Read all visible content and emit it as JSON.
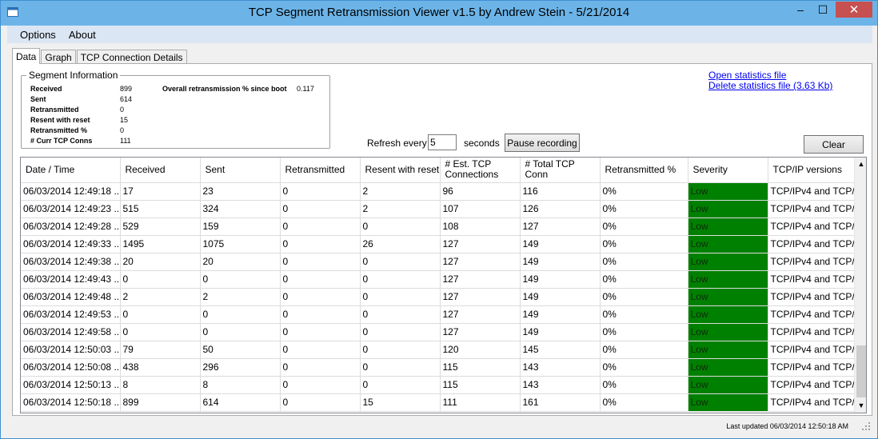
{
  "window": {
    "title": "TCP Segment Retransmission Viewer v1.5 by Andrew Stein - 5/21/2014",
    "minimize_glyph": "–",
    "maximize_glyph": "☐",
    "close_glyph": "✕"
  },
  "menu": [
    {
      "label": "Options"
    },
    {
      "label": "About"
    }
  ],
  "tabs": [
    {
      "label": "Data",
      "active": true
    },
    {
      "label": "Graph",
      "active": false
    },
    {
      "label": "TCP Connection Details",
      "active": false
    }
  ],
  "segment_info": {
    "title": "Segment Information",
    "stats": [
      {
        "label": "Received",
        "value": "899"
      },
      {
        "label": "Sent",
        "value": "614"
      },
      {
        "label": "Retransmitted",
        "value": "0"
      },
      {
        "label": "Resent with reset",
        "value": "15"
      },
      {
        "label": "Retransmitted %",
        "value": "0"
      },
      {
        "label": "# Curr TCP Conns",
        "value": "111"
      }
    ],
    "overall_label": "Overall retransmission % since boot",
    "overall_value": "0.117"
  },
  "links": {
    "open_stats": "Open statistics file",
    "delete_stats": "Delete statistics file (3.63 Kb)"
  },
  "refresh": {
    "label": "Refresh every",
    "value": "5",
    "unit": "seconds",
    "pause_button": "Pause recording"
  },
  "clear_button": "Clear",
  "grid": {
    "columns": [
      "Date / Time",
      "Received",
      "Sent",
      "Retransmitted",
      "Resent with reset",
      "# Est. TCP Connections",
      "# Total TCP Conn",
      "Retransmitted %",
      "Severity",
      "TCP/IP versions"
    ],
    "rows": [
      [
        "06/03/2014 12:49:18 ...",
        "17",
        "23",
        "0",
        "2",
        "96",
        "116",
        "0%",
        "Low",
        "TCP/IPv4 and TCP/I"
      ],
      [
        "06/03/2014 12:49:23 ...",
        "515",
        "324",
        "0",
        "2",
        "107",
        "126",
        "0%",
        "Low",
        "TCP/IPv4 and TCP/I"
      ],
      [
        "06/03/2014 12:49:28 ...",
        "529",
        "159",
        "0",
        "0",
        "108",
        "127",
        "0%",
        "Low",
        "TCP/IPv4 and TCP/I"
      ],
      [
        "06/03/2014 12:49:33 ...",
        "1495",
        "1075",
        "0",
        "26",
        "127",
        "149",
        "0%",
        "Low",
        "TCP/IPv4 and TCP/I"
      ],
      [
        "06/03/2014 12:49:38 ...",
        "20",
        "20",
        "0",
        "0",
        "127",
        "149",
        "0%",
        "Low",
        "TCP/IPv4 and TCP/I"
      ],
      [
        "06/03/2014 12:49:43 ...",
        "0",
        "0",
        "0",
        "0",
        "127",
        "149",
        "0%",
        "Low",
        "TCP/IPv4 and TCP/I"
      ],
      [
        "06/03/2014 12:49:48 ...",
        "2",
        "2",
        "0",
        "0",
        "127",
        "149",
        "0%",
        "Low",
        "TCP/IPv4 and TCP/I"
      ],
      [
        "06/03/2014 12:49:53 ...",
        "0",
        "0",
        "0",
        "0",
        "127",
        "149",
        "0%",
        "Low",
        "TCP/IPv4 and TCP/I"
      ],
      [
        "06/03/2014 12:49:58 ...",
        "0",
        "0",
        "0",
        "0",
        "127",
        "149",
        "0%",
        "Low",
        "TCP/IPv4 and TCP/I"
      ],
      [
        "06/03/2014 12:50:03 ...",
        "79",
        "50",
        "0",
        "0",
        "120",
        "145",
        "0%",
        "Low",
        "TCP/IPv4 and TCP/I"
      ],
      [
        "06/03/2014 12:50:08 ...",
        "438",
        "296",
        "0",
        "0",
        "115",
        "143",
        "0%",
        "Low",
        "TCP/IPv4 and TCP/I"
      ],
      [
        "06/03/2014 12:50:13 ...",
        "8",
        "8",
        "0",
        "0",
        "115",
        "143",
        "0%",
        "Low",
        "TCP/IPv4 and TCP/I"
      ],
      [
        "06/03/2014 12:50:18 ...",
        "899",
        "614",
        "0",
        "15",
        "111",
        "161",
        "0%",
        "Low",
        "TCP/IPv4 and TCP/I"
      ]
    ]
  },
  "status": {
    "text": "Last updated 06/03/2014 12:50:18 AM"
  },
  "colors": {
    "severity_low": "#008000",
    "link": "#0000ee",
    "titlebar": "#6cb4e8",
    "close": "#c75050"
  },
  "icons": {
    "app": "app-window-icon",
    "scroll_up": "▲",
    "scroll_down": "▼"
  }
}
